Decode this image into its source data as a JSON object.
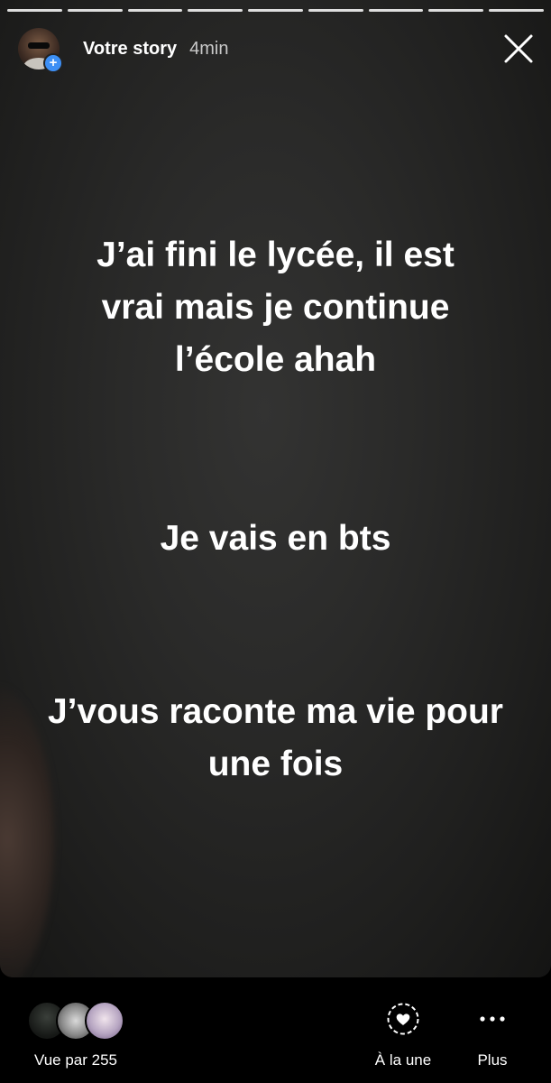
{
  "header": {
    "username": "Votre story",
    "time": "4min",
    "close_icon": "close-icon",
    "add_icon": "plus-badge-icon",
    "progress_segments": 9
  },
  "story": {
    "text_blocks": [
      "J’ai fini le lycée, il est vrai mais je continue l’école ahah",
      "Je vais en bts",
      "J’vous raconte ma vie pour une fois"
    ],
    "text_color": "#ffffff"
  },
  "footer": {
    "seen_by": "Vue par 255",
    "highlight_label": "À la une",
    "more_label": "Plus",
    "highlight_icon": "heart-circle-icon",
    "more_icon": "more-dots-icon"
  }
}
